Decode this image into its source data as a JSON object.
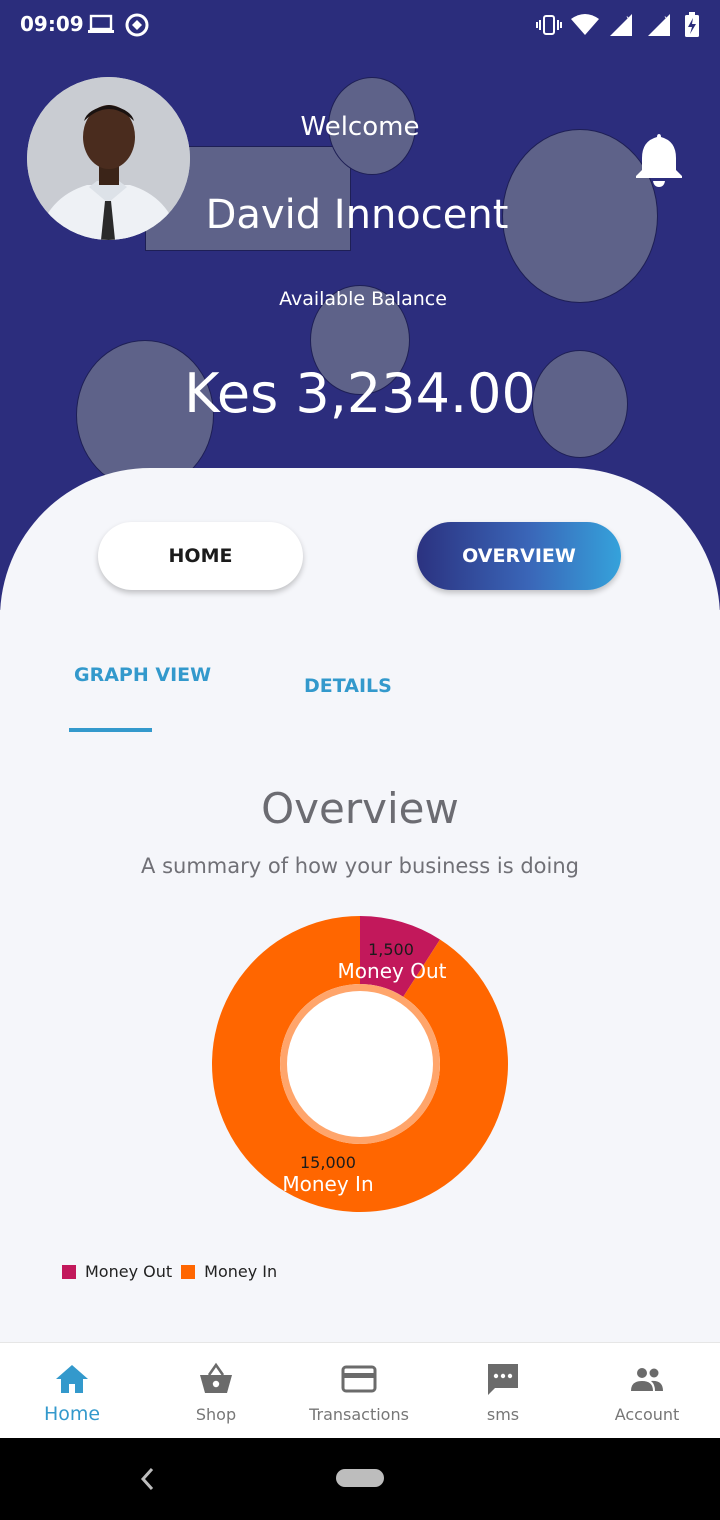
{
  "status_bar": {
    "time": "09:09"
  },
  "profile": {
    "welcome": "Welcome",
    "name": "David Innocent",
    "balance_label": "Available Balance",
    "balance_value": "Kes 3,234.00"
  },
  "toggle": {
    "home_label": "HOME",
    "overview_label": "OVERVIEW",
    "active": "OVERVIEW"
  },
  "tabs": {
    "graph_view": "GRAPH VIEW",
    "details": "DETAILS",
    "active": "GRAPH VIEW"
  },
  "overview": {
    "title": "Overview",
    "subtitle": "A summary of how your business is doing"
  },
  "chart_data": {
    "type": "pie",
    "donut": true,
    "categories": [
      "Money Out",
      "Money In"
    ],
    "values": [
      1500,
      15000
    ],
    "value_labels": [
      "1,500",
      "15,000"
    ],
    "colors": [
      "#c2185b",
      "#ff6600"
    ],
    "legend": "bottom-left"
  },
  "bottom_nav": {
    "items": [
      {
        "label": "Home",
        "icon": "home-icon",
        "active": true
      },
      {
        "label": "Shop",
        "icon": "basket-icon",
        "active": false
      },
      {
        "label": "Transactions",
        "icon": "credit-card-icon",
        "active": false
      },
      {
        "label": "sms",
        "icon": "chat-icon",
        "active": false
      },
      {
        "label": "Account",
        "icon": "people-icon",
        "active": false
      }
    ]
  },
  "colors": {
    "header_bg": "#2c2d7d",
    "accent": "#3399cc",
    "money_out": "#c2185b",
    "money_in": "#ff6600"
  }
}
